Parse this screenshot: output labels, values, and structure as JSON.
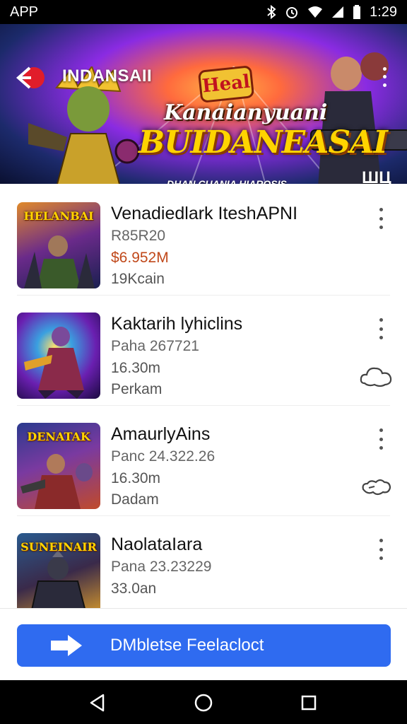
{
  "status_bar": {
    "left_label": "APP",
    "time": "1:29",
    "icons": [
      "bluetooth-icon",
      "alarm-icon",
      "wifi-icon",
      "signal-icon",
      "battery-icon"
    ]
  },
  "header": {
    "title": "INDANSAII",
    "back_icon": "back-arrow-icon",
    "menu_icon": "more-vert-icon"
  },
  "banner": {
    "logo_text": "Heal",
    "headline_line1": "Kanaianyuani",
    "headline_line2": "BUIDANEASAI",
    "tagline": "DHAN CUANIA HIAROSIS.",
    "corner_mark": "ШЦ"
  },
  "apps": [
    {
      "title": "Venadiedlark IteshAPNI",
      "line1": "R85R20",
      "line2": "$6.952M",
      "line3": "19Kcain",
      "thumb_label": "HELANBAI",
      "thumb_colors": [
        "#3a2a6e",
        "#e08a2a"
      ],
      "side_icon": null
    },
    {
      "title": "Kaktarih lyhiclins",
      "line1": "Paha 267721",
      "line2": "16.30m",
      "line3": "Perkam",
      "thumb_label": "",
      "thumb_colors": [
        "#5a1fa8",
        "#2aa5e0"
      ],
      "side_icon": "cloud-icon"
    },
    {
      "title": "AmaurlyAins",
      "line1": "Panc 24.322.26",
      "line2": "16.30m",
      "line3": "Dadam",
      "thumb_label": "DENATAK",
      "thumb_colors": [
        "#2a3a8e",
        "#c04a2a"
      ],
      "side_icon": "cloud-outline-icon"
    },
    {
      "title": "NaolataIara",
      "line1": "Pana 23.23229",
      "line2": "33.0an",
      "line3": "",
      "thumb_label": "SUNEINAIR",
      "thumb_colors": [
        "#2a4a6e",
        "#e0a02a"
      ],
      "side_icon": null
    }
  ],
  "download_button": {
    "label": "DMbletse Feelacloct",
    "icon": "arrow-right-icon"
  },
  "nav": {
    "back": "nav-back-icon",
    "home": "nav-home-icon",
    "recents": "nav-recents-icon"
  },
  "colors": {
    "accent": "#2f6bf0",
    "price": "#c0481a"
  }
}
